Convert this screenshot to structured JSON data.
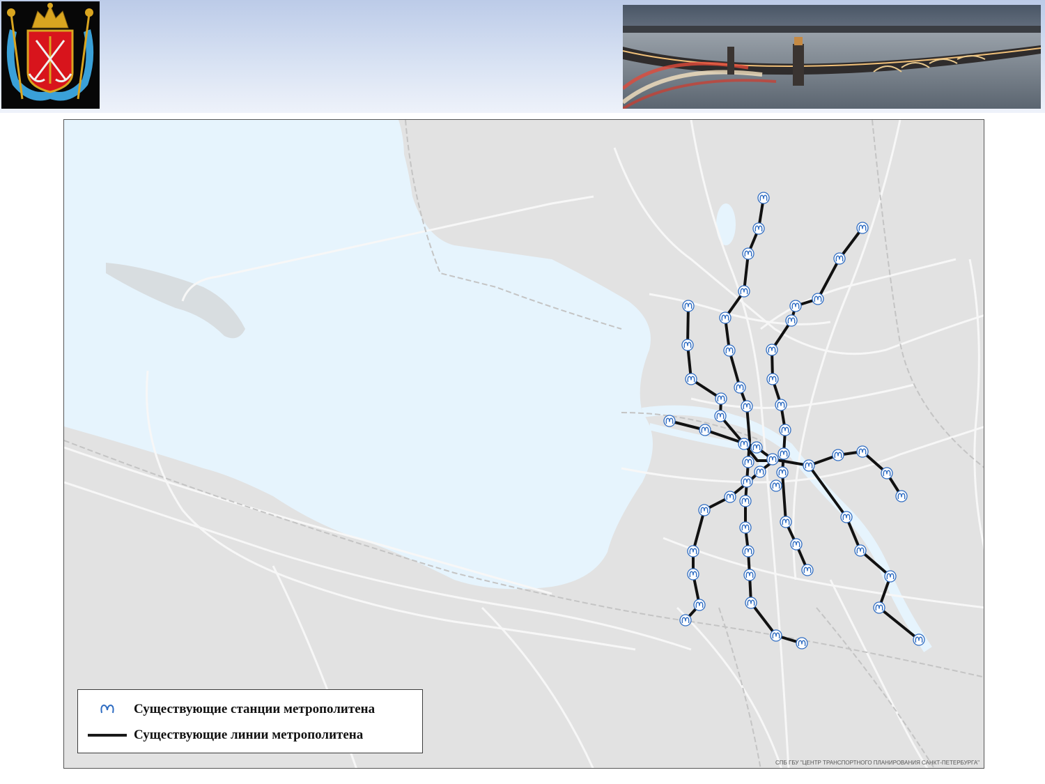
{
  "header": {
    "emblem_name": "coat-of-arms",
    "photo_name": "city-bridge-photo"
  },
  "map": {
    "colors": {
      "water": "#e6f4fd",
      "land": "#e2e2e2",
      "roads": "#ffffff",
      "metro_line": "#111111",
      "station_icon": "#2e6cc2"
    },
    "station_icon": "metro-m-icon",
    "credit": "СПБ ГБУ \"ЦЕНТР ТРАНСПОРТНОГО ПЛАНИРОВАНИЯ САНКТ-ПЕТЕРБУРГА\""
  },
  "legend": {
    "stations_label": "Существующие станции метрополитена",
    "lines_label": "Существующие линии метрополитена"
  }
}
